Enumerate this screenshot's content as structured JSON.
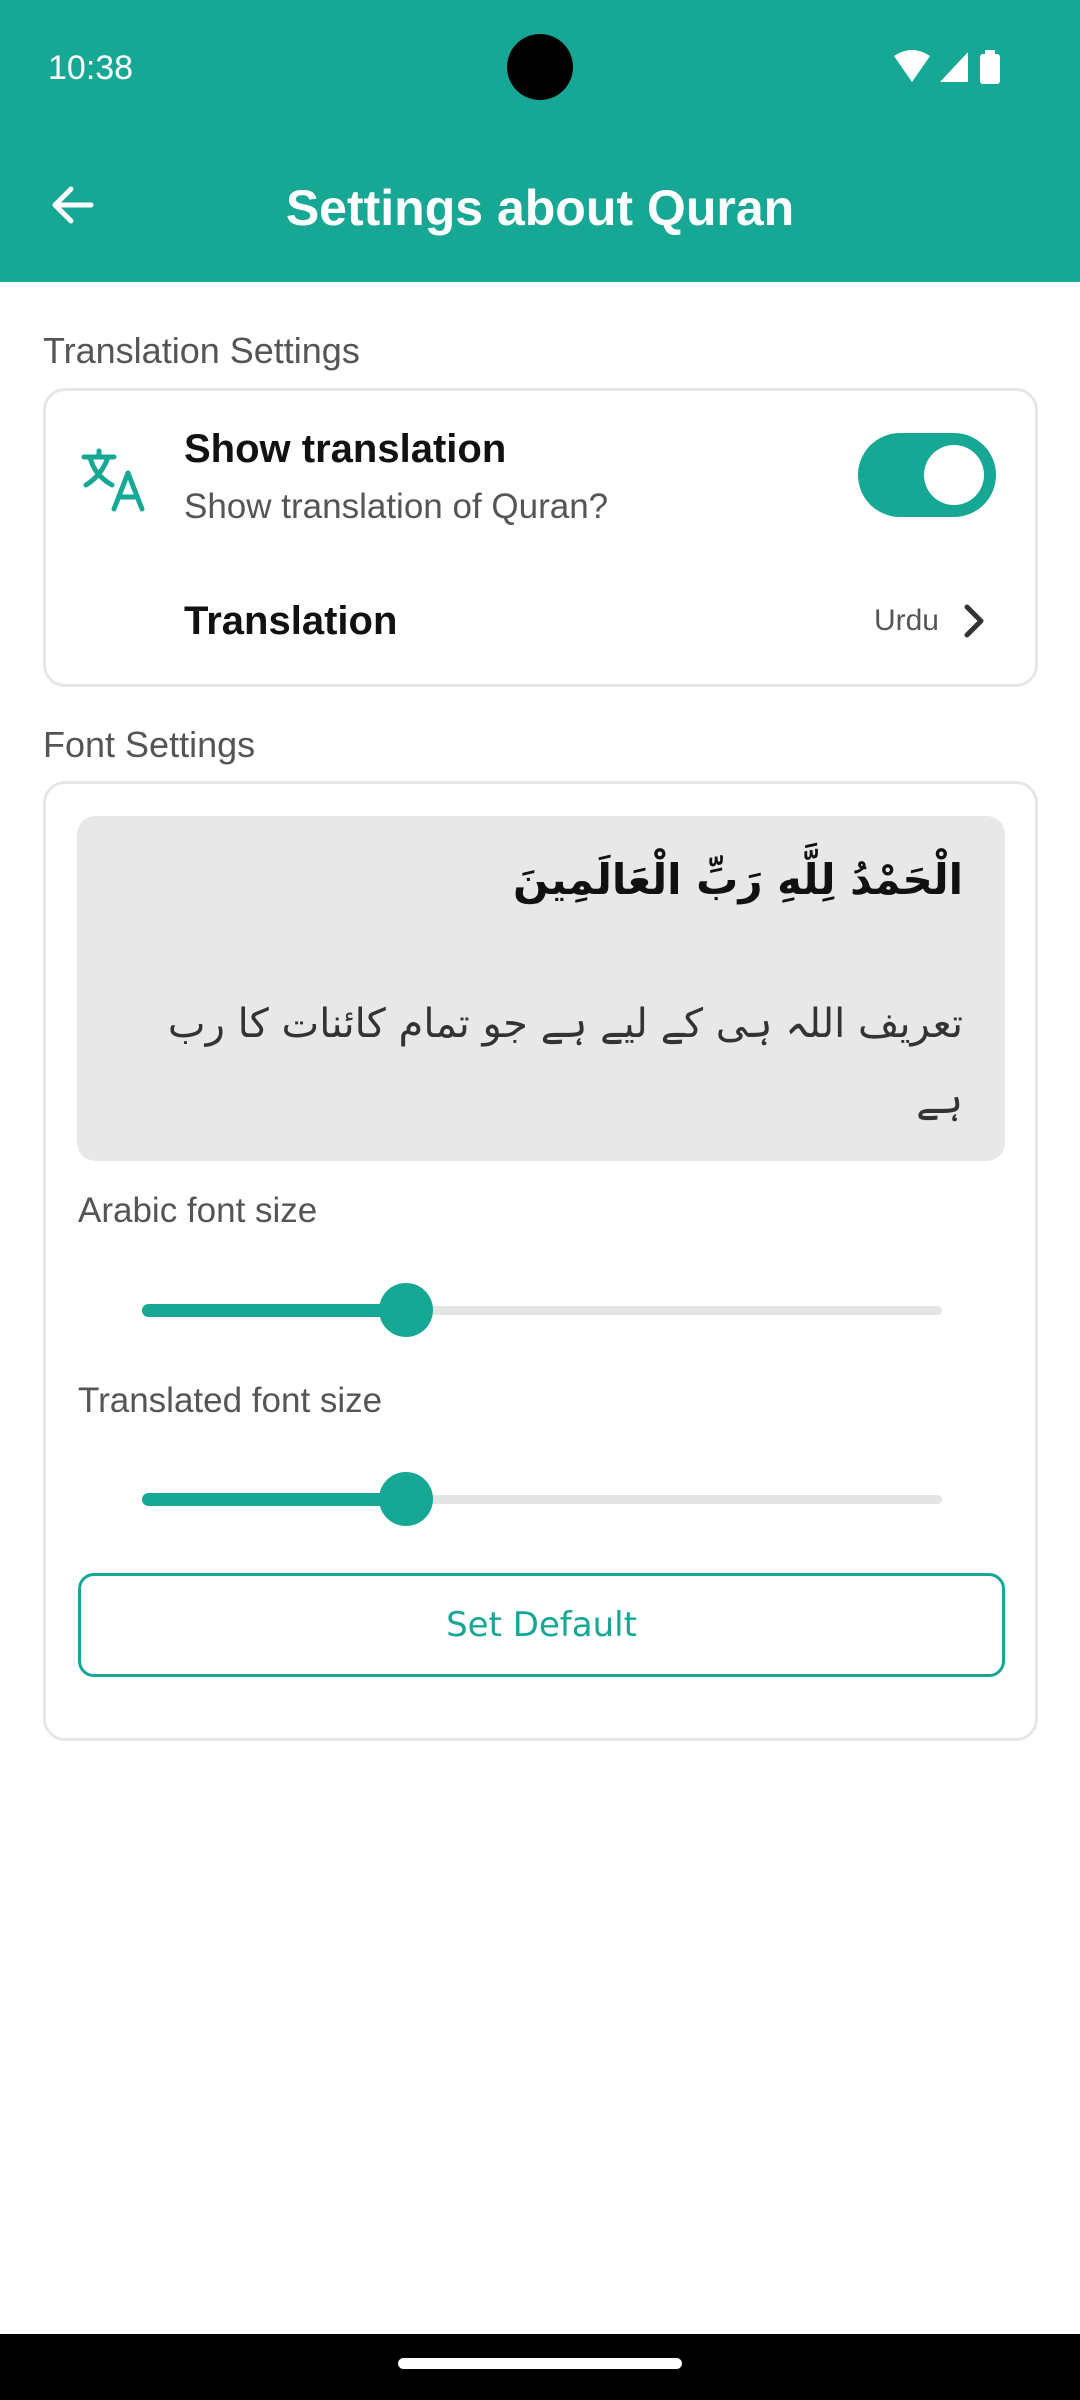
{
  "status_bar": {
    "time": "10:38",
    "icons": [
      "wifi-icon",
      "signal-icon",
      "battery-icon"
    ]
  },
  "app_bar": {
    "title": "Settings about Quran",
    "back_icon": "arrow-left-icon",
    "background_color": "#16a894"
  },
  "translation_settings": {
    "section_label": "Translation Settings",
    "show_translation": {
      "icon": "translate-icon",
      "title": "Show translation",
      "subtitle": "Show translation of Quran?",
      "enabled": true
    },
    "translation": {
      "title": "Translation",
      "value": "Urdu",
      "icon": "chevron-right-icon"
    }
  },
  "font_settings": {
    "section_label": "Font Settings",
    "preview": {
      "arabic_text": "الْحَمْدُ لِلَّهِ رَبِّ الْعَالَمِينَ",
      "translated_text": "تعریف اللہ ہی کے لیے ہے جو تمام کائنات کا رب ہے"
    },
    "arabic_font_size": {
      "label": "Arabic font size",
      "value_fraction": 0.33
    },
    "translated_font_size": {
      "label": "Translated font size",
      "value_fraction": 0.33
    },
    "set_default_label": "Set Default"
  },
  "colors": {
    "accent": "#16a894",
    "section_text": "#555555"
  }
}
